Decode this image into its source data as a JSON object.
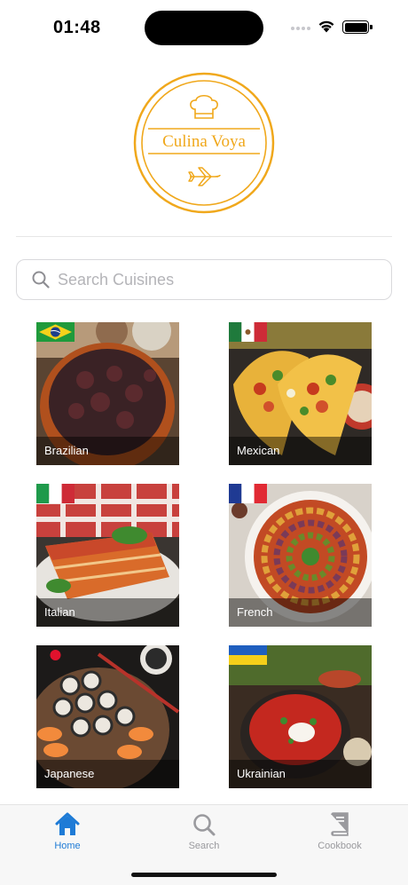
{
  "status_bar": {
    "time": "01:48"
  },
  "logo": {
    "text": "Culina Voya",
    "color": "#f0a81c"
  },
  "search": {
    "placeholder": "Search Cuisines",
    "value": ""
  },
  "cuisines": [
    {
      "name": "Brazilian",
      "flag": "brazil-flag"
    },
    {
      "name": "Mexican",
      "flag": "mexico-flag"
    },
    {
      "name": "Italian",
      "flag": "italy-flag"
    },
    {
      "name": "French",
      "flag": "france-flag"
    },
    {
      "name": "Japanese",
      "flag": "japan-flag"
    },
    {
      "name": "Ukrainian",
      "flag": "ukraine-flag"
    }
  ],
  "tabbar": {
    "tabs": [
      {
        "label": "Home",
        "icon": "house-icon",
        "active": true
      },
      {
        "label": "Search",
        "icon": "magnifier-icon",
        "active": false
      },
      {
        "label": "Cookbook",
        "icon": "book-icon",
        "active": false
      }
    ]
  },
  "colors": {
    "accent": "#1e7bd6",
    "logo": "#f0a81c",
    "inactive": "#9a9a9e"
  }
}
